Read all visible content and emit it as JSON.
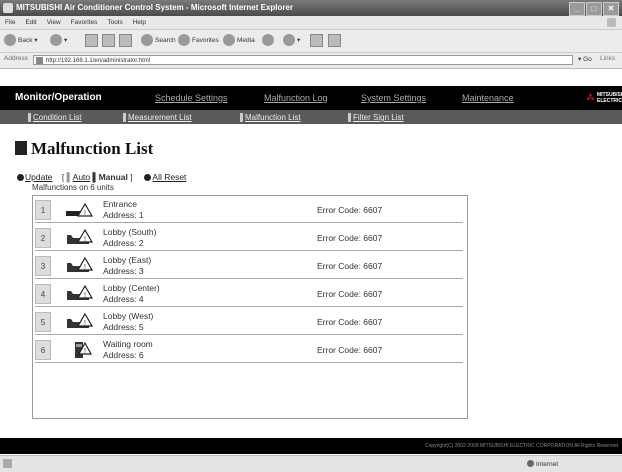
{
  "window": {
    "title": "MITSUBISHI Air Conditioner Control System - Microsoft Internet Explorer"
  },
  "menubar": {
    "items": [
      "File",
      "Edit",
      "View",
      "Favorites",
      "Tools",
      "Help"
    ]
  },
  "toolbar": {
    "back": "Back",
    "search": "Search",
    "favorites": "Favorites",
    "media": "Media"
  },
  "addressbar": {
    "label": "Address",
    "url": "http://192.168.1.1/en/administrator.html",
    "go": "Go",
    "links": "Links"
  },
  "nav": {
    "items": [
      "Monitor/Operation",
      "Schedule Settings",
      "Malfunction Log",
      "System Settings",
      "Maintenance"
    ],
    "logo": "MITSUBISHI ELECTRIC"
  },
  "subnav": {
    "items": [
      "Condition List",
      "Measurement List",
      "Malfunction List",
      "Filter Sign List"
    ]
  },
  "page": {
    "title": "Malfunction List",
    "update": "Update",
    "bracket_open": "[",
    "auto": "Auto",
    "manual": "Manual",
    "bracket_close": "]",
    "all_reset": "All Reset",
    "summary": "Malfunctions on 6 units"
  },
  "rows": [
    {
      "num": "1",
      "name": "Entrance",
      "address": "Address: 1",
      "error": "Error Code: 6607",
      "icon": "wall-unit-warning-icon"
    },
    {
      "num": "2",
      "name": "Lobby (South)",
      "address": "Address: 2",
      "error": "Error Code: 6607",
      "icon": "ceiling-unit-warning-icon"
    },
    {
      "num": "3",
      "name": "Lobby (East)",
      "address": "Address: 3",
      "error": "Error Code: 6607",
      "icon": "ceiling-unit-warning-icon"
    },
    {
      "num": "4",
      "name": "Lobby (Center)",
      "address": "Address: 4",
      "error": "Error Code: 6607",
      "icon": "ceiling-unit-warning-icon"
    },
    {
      "num": "5",
      "name": "Lobby (West)",
      "address": "Address: 5",
      "error": "Error Code: 6607",
      "icon": "ceiling-unit-warning-icon"
    },
    {
      "num": "6",
      "name": "Waiting room",
      "address": "Address: 6",
      "error": "Error Code: 6607",
      "icon": "floor-unit-warning-icon"
    }
  ],
  "footer": {
    "copyright": "Copyright(C) 2002-2008 MITSUBISHI ELECTRIC CORPORATION All Rights Reserved"
  },
  "status": {
    "zone": "Internet"
  },
  "colors": {
    "nav_bg": "#000000",
    "subnav_bg": "#5a5a5a",
    "logo_red": "#d0101b"
  }
}
